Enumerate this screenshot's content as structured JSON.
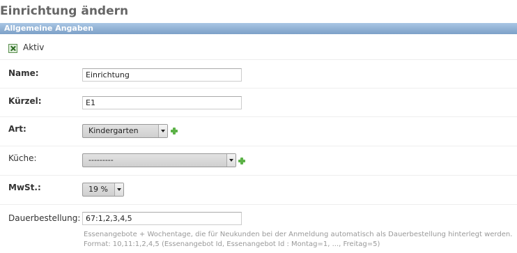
{
  "page": {
    "title": "Einrichtung ändern"
  },
  "fieldset": {
    "title": "Allgemeine Angaben"
  },
  "form": {
    "aktiv_label": "Aktiv",
    "aktiv_checked": true,
    "name": {
      "label": "Name:",
      "value": "Einrichtung"
    },
    "kuerzel": {
      "label": "Kürzel:",
      "value": "E1"
    },
    "art": {
      "label": "Art:",
      "selected": "Kindergarten"
    },
    "kueche": {
      "label": "Küche:",
      "selected": "---------"
    },
    "mwst": {
      "label": "MwSt.:",
      "selected": "19 %"
    },
    "dauerbestellung": {
      "label": "Dauerbestellung:",
      "value": "67:1,2,3,4,5",
      "help_line1": "Essenangebote + Wochentage, die für Neukunden bei der Anmeldung automatisch als Dauerbestellung hinterlegt werden.",
      "help_line2": "Format: 10,11:1,2,4,5 (Essenangebot Id, Essenangebot Id : Montag=1, ..., Freitag=5)"
    }
  },
  "icons": {
    "add": "add-icon",
    "checkbox": "checked-checkbox-icon"
  },
  "colors": {
    "header_gradient_top": "#a9c6e4",
    "header_gradient_bottom": "#7ca0c7",
    "add_icon": "#5cb247"
  }
}
